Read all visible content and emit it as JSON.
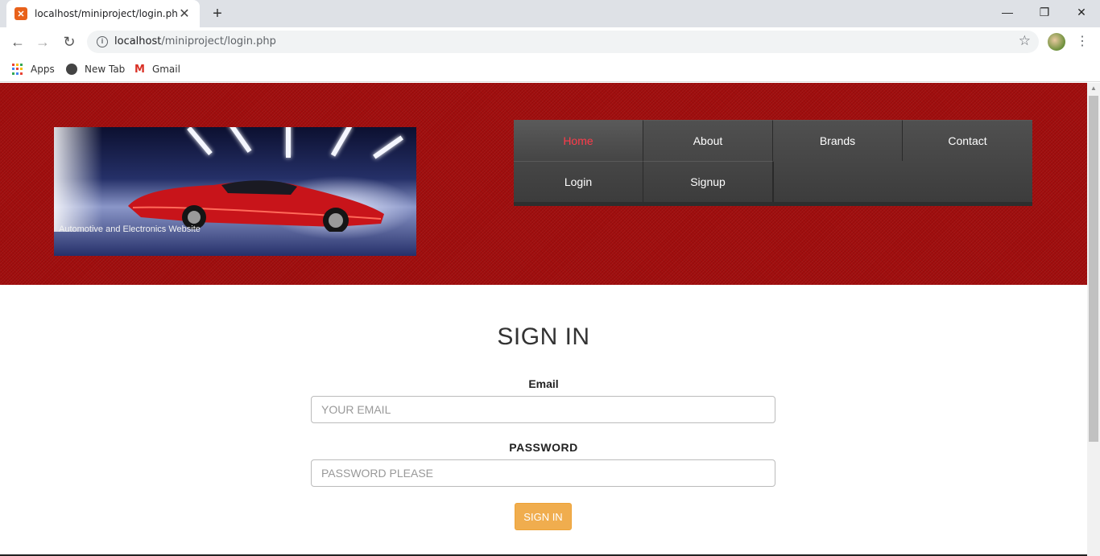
{
  "browser": {
    "tab_title": "localhost/miniproject/login.php",
    "tab_close": "✕",
    "new_tab": "+",
    "url_host": "localhost",
    "url_path": "/miniproject/login.php",
    "window_controls": {
      "minimize": "—",
      "restore": "❐",
      "close": "✕"
    },
    "bookmarks": [
      {
        "label": "Apps",
        "icon": "apps-grid-icon"
      },
      {
        "label": "New Tab",
        "icon": "globe-icon"
      },
      {
        "label": "Gmail",
        "icon": "gmail-icon"
      }
    ]
  },
  "banner": {
    "caption": "Automotive and Electronics Website"
  },
  "nav": {
    "items": [
      {
        "label": "Home",
        "active": true
      },
      {
        "label": "About"
      },
      {
        "label": "Brands"
      },
      {
        "label": "Contact"
      },
      {
        "label": "Login"
      },
      {
        "label": "Signup"
      }
    ]
  },
  "form": {
    "title": "SIGN IN",
    "email_label": "Email",
    "email_placeholder": "YOUR EMAIL",
    "password_label": "PASSWORD",
    "password_placeholder": "PASSWORD PLEASE",
    "submit_label": "SIGN IN"
  },
  "colors": {
    "header_red": "#a00d0d",
    "nav_dark": "#444444",
    "nav_active_text": "#ff3b4a",
    "button_orange": "#f0ad4e"
  }
}
